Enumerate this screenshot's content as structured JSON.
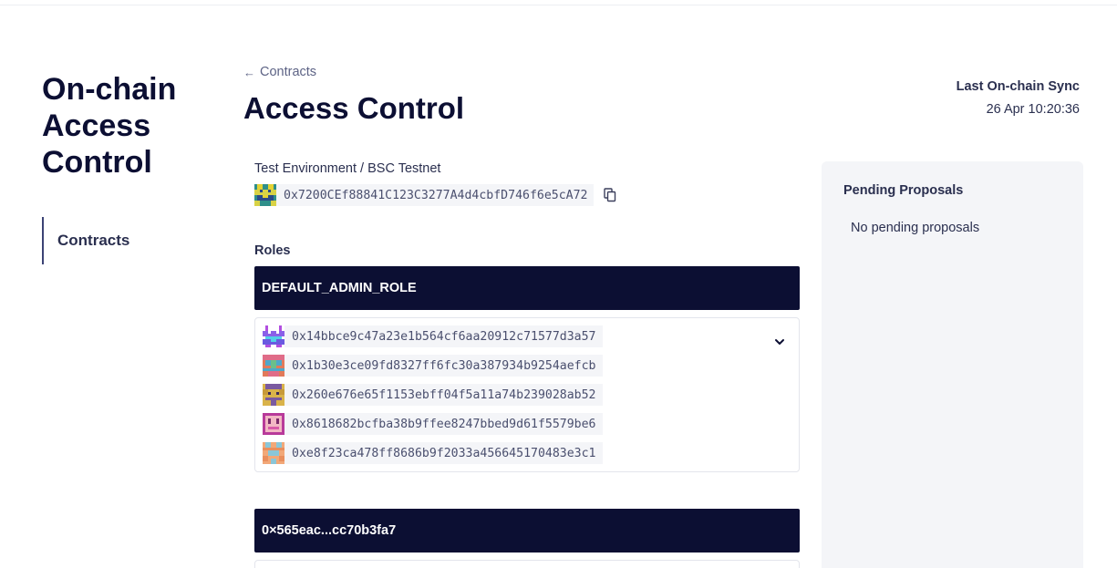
{
  "sidebar": {
    "title_lines": [
      "On-chain",
      "Access",
      "Control"
    ],
    "nav_items": [
      {
        "label": "Contracts",
        "active": true
      }
    ]
  },
  "header": {
    "back_label": "Contracts",
    "title": "Access Control",
    "sync_label": "Last On-chain Sync",
    "sync_time": "26 Apr 10:20:36"
  },
  "contract": {
    "environment": "Test Environment / BSC Testnet",
    "address": "0x7200CEf88841C123C3277A4d4cbfD746f6e5cA72",
    "avatar_icon": "identicon-icon"
  },
  "roles": {
    "label": "Roles",
    "items": [
      {
        "name": "DEFAULT_ADMIN_ROLE",
        "expanded": true,
        "members": [
          "0x14bbce9c47a23e1b564cf6aa20912c71577d3a57",
          "0x1b30e3ce09fd8327ff6fc30a387934b9254aefcb",
          "0x260e676e65f1153ebff04f5a11a74b239028ab52",
          "0x8618682bcfba38b9ffee8247bbed9d61f5579be6",
          "0xe8f23ca478ff8686b9f2033a456645170483e3c1"
        ]
      },
      {
        "name": "0×565eac...cc70b3fa7",
        "expanded": false,
        "members": []
      }
    ]
  },
  "pending": {
    "title": "Pending Proposals",
    "empty_text": "No pending proposals"
  },
  "colors": {
    "navy": "#0c0f33",
    "panel": "#f4f5f8",
    "chip": "#f4f5f8"
  }
}
